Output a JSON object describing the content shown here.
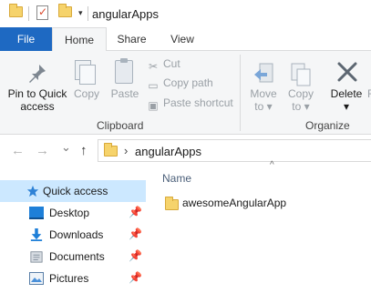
{
  "window": {
    "title": "angularApps"
  },
  "quick_access_toolbar": {
    "dropdown_glyph": "▾"
  },
  "ribbon_tabs": [
    {
      "label": "File",
      "active": false
    },
    {
      "label": "Home",
      "active": true
    },
    {
      "label": "Share",
      "active": false
    },
    {
      "label": "View",
      "active": false
    }
  ],
  "ribbon": {
    "clipboard": {
      "group_label": "Clipboard",
      "pin_to_quick_access": {
        "line1": "Pin to Quick",
        "line2": "access"
      },
      "copy": "Copy",
      "paste": "Paste",
      "cut": "Cut",
      "copy_path": "Copy path",
      "paste_shortcut": "Paste shortcut"
    },
    "organize": {
      "group_label": "Organize",
      "move_to": {
        "line1": "Move",
        "line2": "to"
      },
      "copy_to": {
        "line1": "Copy",
        "line2": "to"
      },
      "delete": "Delete"
    }
  },
  "address_bar": {
    "back_glyph": "←",
    "forward_glyph": "→",
    "recent_glyph": "⌄",
    "up_glyph": "↑",
    "separator_glyph": "›",
    "path": "angularApps"
  },
  "nav_pane": {
    "items": [
      {
        "label": "Quick access",
        "icon": "star-icon",
        "selected": true,
        "pinned": false
      },
      {
        "label": "Desktop",
        "icon": "desktop-icon",
        "selected": false,
        "pinned": true
      },
      {
        "label": "Downloads",
        "icon": "download-icon",
        "selected": false,
        "pinned": true
      },
      {
        "label": "Documents",
        "icon": "documents-icon",
        "selected": false,
        "pinned": true
      },
      {
        "label": "Pictures",
        "icon": "pictures-icon",
        "selected": false,
        "pinned": true
      }
    ]
  },
  "file_list": {
    "column_name": "Name",
    "sort_glyph": "^",
    "items": [
      {
        "name": "awesomeAngularApp",
        "type": "folder"
      }
    ]
  },
  "colors": {
    "file_tab": "#1e69c2",
    "selected_nav": "#cce8ff",
    "folder": "#f6d36b",
    "ribbon_bg": "#f5f6f7"
  }
}
